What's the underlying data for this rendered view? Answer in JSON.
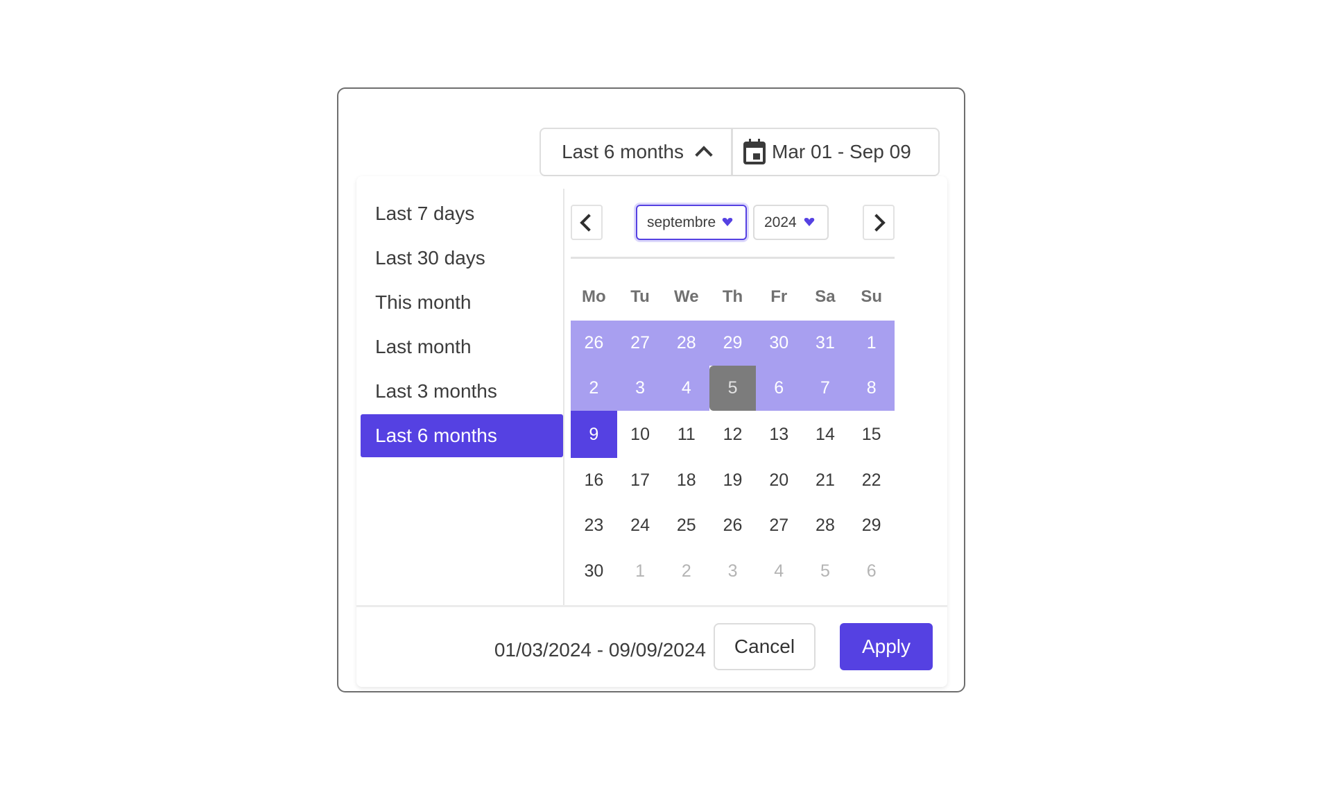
{
  "trigger": {
    "preset_label": "Last 6 months",
    "preset_icon": "chevron-up-icon",
    "range_icon": "calendar-icon",
    "range_label": "Mar 01 - Sep 09"
  },
  "presets": [
    {
      "label": "Last 7 days",
      "active": false
    },
    {
      "label": "Last 30 days",
      "active": false
    },
    {
      "label": "This month",
      "active": false
    },
    {
      "label": "Last month",
      "active": false
    },
    {
      "label": "Last 3 months",
      "active": false
    },
    {
      "label": "Last 6 months",
      "active": true
    }
  ],
  "calendar": {
    "month": "septembre",
    "year": "2024",
    "prev_icon": "chevron-left-icon",
    "next_icon": "chevron-right-icon",
    "weekdays": [
      "Mo",
      "Tu",
      "We",
      "Th",
      "Fr",
      "Sa",
      "Su"
    ],
    "weeks": [
      [
        {
          "d": "26",
          "s": "inrange"
        },
        {
          "d": "27",
          "s": "inrange"
        },
        {
          "d": "28",
          "s": "inrange"
        },
        {
          "d": "29",
          "s": "inrange"
        },
        {
          "d": "30",
          "s": "inrange"
        },
        {
          "d": "31",
          "s": "inrange"
        },
        {
          "d": "1",
          "s": "inrange"
        }
      ],
      [
        {
          "d": "2",
          "s": "inrange"
        },
        {
          "d": "3",
          "s": "inrange"
        },
        {
          "d": "4",
          "s": "inrange"
        },
        {
          "d": "5",
          "s": "today"
        },
        {
          "d": "6",
          "s": "inrange"
        },
        {
          "d": "7",
          "s": "inrange"
        },
        {
          "d": "8",
          "s": "inrange"
        }
      ],
      [
        {
          "d": "9",
          "s": "selected"
        },
        {
          "d": "10",
          "s": ""
        },
        {
          "d": "11",
          "s": ""
        },
        {
          "d": "12",
          "s": ""
        },
        {
          "d": "13",
          "s": ""
        },
        {
          "d": "14",
          "s": ""
        },
        {
          "d": "15",
          "s": ""
        }
      ],
      [
        {
          "d": "16",
          "s": ""
        },
        {
          "d": "17",
          "s": ""
        },
        {
          "d": "18",
          "s": ""
        },
        {
          "d": "19",
          "s": ""
        },
        {
          "d": "20",
          "s": ""
        },
        {
          "d": "21",
          "s": ""
        },
        {
          "d": "22",
          "s": ""
        }
      ],
      [
        {
          "d": "23",
          "s": ""
        },
        {
          "d": "24",
          "s": ""
        },
        {
          "d": "25",
          "s": ""
        },
        {
          "d": "26",
          "s": ""
        },
        {
          "d": "27",
          "s": ""
        },
        {
          "d": "28",
          "s": ""
        },
        {
          "d": "29",
          "s": ""
        }
      ],
      [
        {
          "d": "30",
          "s": ""
        },
        {
          "d": "1",
          "s": "muted"
        },
        {
          "d": "2",
          "s": "muted"
        },
        {
          "d": "3",
          "s": "muted"
        },
        {
          "d": "4",
          "s": "muted"
        },
        {
          "d": "5",
          "s": "muted"
        },
        {
          "d": "6",
          "s": "muted"
        }
      ]
    ]
  },
  "footer": {
    "range_text": "01/03/2024 - 09/09/2024",
    "cancel_label": "Cancel",
    "apply_label": "Apply"
  },
  "colors": {
    "accent": "#5541e2",
    "range_fill": "#a89ff0",
    "today_fill": "#7c7c7c"
  }
}
